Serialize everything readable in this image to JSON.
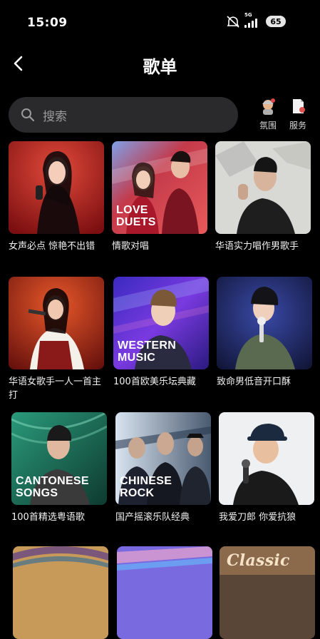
{
  "status": {
    "time": "15:09",
    "network": "5G",
    "battery": "65"
  },
  "header": {
    "title": "歌单"
  },
  "search": {
    "placeholder": "搜索"
  },
  "tools": [
    {
      "label": "氛围",
      "icon": "atmosphere-icon"
    },
    {
      "label": "服务",
      "icon": "service-icon"
    }
  ],
  "playlists": [
    {
      "title": "女声必点 惊艳不出错",
      "cover_text": ""
    },
    {
      "title": "情歌对唱",
      "cover_text": "LOVE DUETS"
    },
    {
      "title": "华语实力唱作男歌手",
      "cover_text": ""
    },
    {
      "title": "华语女歌手一人一首主打",
      "cover_text": ""
    },
    {
      "title": "100首欧美乐坛典藏",
      "cover_text": "WESTERN MUSIC"
    },
    {
      "title": "致命男低音开口酥",
      "cover_text": ""
    },
    {
      "title": "100首精选粤语歌",
      "cover_text": "CANTONESE SONGS"
    },
    {
      "title": "国产摇滚乐队经典",
      "cover_text": "CHINESE ROCK"
    },
    {
      "title": "我爱刀郎 你爱抗狼",
      "cover_text": ""
    }
  ],
  "bottom_row_cover_text": [
    "",
    "",
    "Classic"
  ],
  "colors": {
    "background": "#000000",
    "search_bg": "#2a2a2c",
    "text_primary": "#ffffff",
    "text_secondary": "#9a9a9a"
  }
}
